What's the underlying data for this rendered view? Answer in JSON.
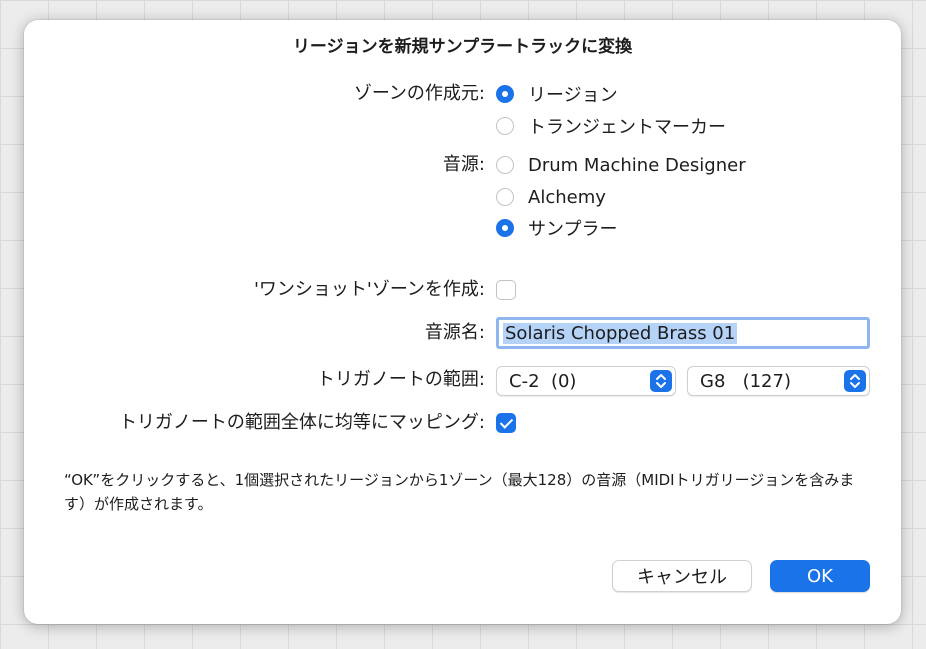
{
  "dialog": {
    "title": "リージョンを新規サンプラートラックに変換",
    "zone_source": {
      "label": "ゾーンの作成元:",
      "options": [
        {
          "label": "リージョン",
          "selected": true
        },
        {
          "label": "トランジェントマーカー",
          "selected": false
        }
      ]
    },
    "instrument": {
      "label": "音源:",
      "options": [
        {
          "label": "Drum Machine Designer",
          "selected": false
        },
        {
          "label": "Alchemy",
          "selected": false
        },
        {
          "label": "サンプラー",
          "selected": true
        }
      ]
    },
    "one_shot": {
      "label": "'ワンショット'ゾーンを作成:",
      "checked": false
    },
    "instrument_name": {
      "label": "音源名:",
      "value": "Solaris Chopped Brass 01"
    },
    "trigger_range": {
      "label": "トリガノートの範囲:",
      "low": "C-2  (0)",
      "high": "G8   (127)"
    },
    "map_evenly": {
      "label": "トリガノートの範囲全体に均等にマッピング:",
      "checked": true
    },
    "description": "“OK”をクリックすると、1個選択されたリージョンから1ゾーン（最大128）の音源（MIDIトリガリージョンを含みます）が作成されます。",
    "buttons": {
      "cancel": "キャンセル",
      "ok": "OK"
    }
  },
  "colors": {
    "accent": "#1a73e8",
    "selection": "#b5d3f7",
    "focus_ring": "#8fb6ef"
  },
  "icons": {
    "popup_stepper": "chevron-up-down-icon",
    "check": "checkmark-icon"
  }
}
